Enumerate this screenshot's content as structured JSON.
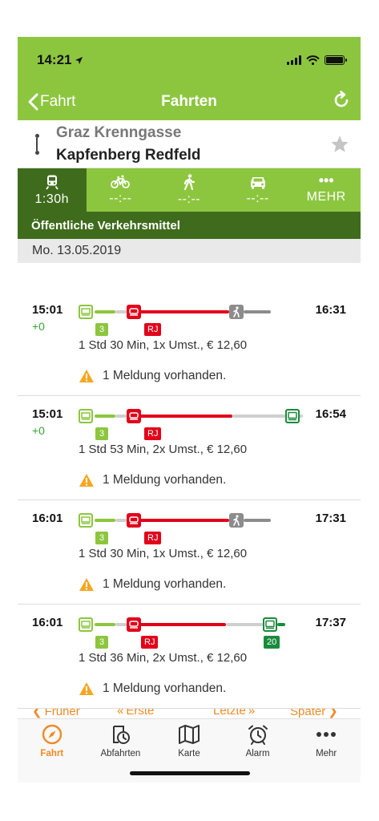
{
  "status": {
    "time": "14:21"
  },
  "navbar": {
    "back_label": "Fahrt",
    "title": "Fahrten"
  },
  "route": {
    "from": "Graz Krenngasse",
    "to": "Kapfenberg Redfeld"
  },
  "modes": [
    {
      "value": "1:30h",
      "icon": "train-icon",
      "active": true
    },
    {
      "value": "--:--",
      "icon": "bicycle-icon",
      "active": false
    },
    {
      "value": "--:--",
      "icon": "walking-icon",
      "active": false
    },
    {
      "value": "--:--",
      "icon": "car-icon",
      "active": false
    },
    {
      "value": "MEHR",
      "icon": "more-dots-icon",
      "active": false
    }
  ],
  "section_title": "Öffentliche Verkehrsmittel",
  "date": "Mo. 13.05.2019",
  "colors": {
    "green": "#8cc63f",
    "dark_green": "#3f6c1c",
    "red": "#e2001a",
    "orange": "#f08a24",
    "grey": "#8c8c8c",
    "bus_green": "#1a8a3c"
  },
  "trips": [
    {
      "dep": "15:01",
      "delay": "+0",
      "arr": "16:31",
      "summary": "1 Std 30 Min,  1x Umst.,  € 12,60",
      "notice": "1 Meldung vorhanden.",
      "badges": [
        "3",
        "RJ"
      ],
      "end": "walk"
    },
    {
      "dep": "15:01",
      "delay": "+0",
      "arr": "16:54",
      "summary": "1 Std 53 Min,  2x Umst.,  € 12,60",
      "notice": "1 Meldung vorhanden.",
      "badges": [
        "3",
        "RJ"
      ],
      "end": "bus"
    },
    {
      "dep": "16:01",
      "delay": "",
      "arr": "17:31",
      "summary": "1 Std 30 Min,  1x Umst.,  € 12,60",
      "notice": "1 Meldung vorhanden.",
      "badges": [
        "3",
        "RJ"
      ],
      "end": "walk"
    },
    {
      "dep": "16:01",
      "delay": "",
      "arr": "17:37",
      "summary": "1 Std 36 Min,  2x Umst.,  € 12,60",
      "notice": "1 Meldung vorhanden.",
      "badges": [
        "3",
        "RJ",
        "20"
      ],
      "end": "bus-badge"
    }
  ],
  "pager": {
    "earlier": "Früher",
    "first": "Erste",
    "last": "Letzte",
    "later": "Später"
  },
  "tabs": [
    {
      "label": "Fahrt",
      "icon": "compass-icon",
      "active": true
    },
    {
      "label": "Abfahrten",
      "icon": "clock-phone-icon",
      "active": false
    },
    {
      "label": "Karte",
      "icon": "map-icon",
      "active": false
    },
    {
      "label": "Alarm",
      "icon": "alarm-clock-icon",
      "active": false
    },
    {
      "label": "Mehr",
      "icon": "more-dots-icon",
      "active": false
    }
  ]
}
